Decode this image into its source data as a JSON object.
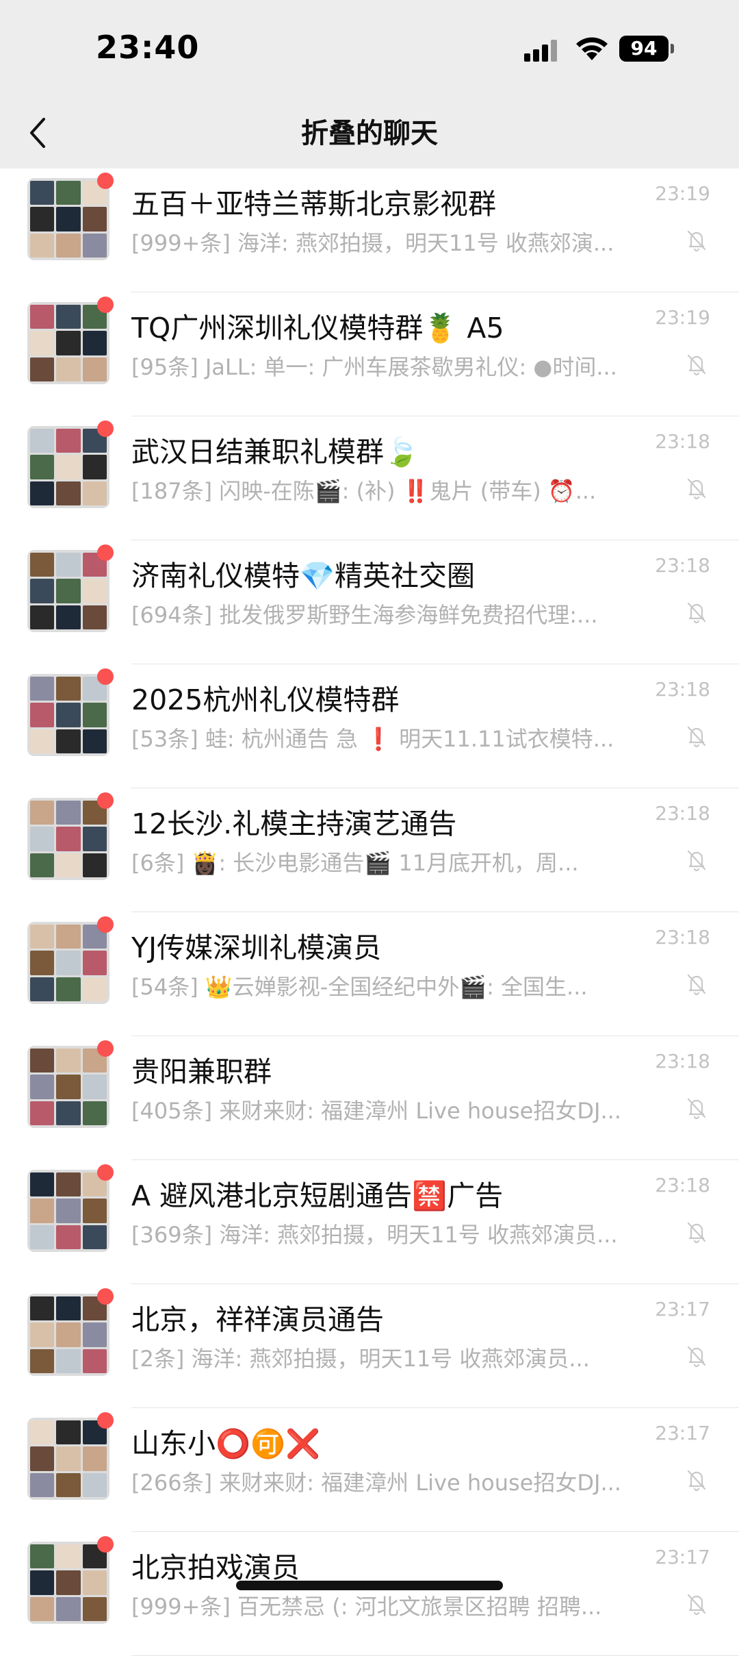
{
  "status": {
    "time": "23:40",
    "battery": "94"
  },
  "header": {
    "title": "折叠的聊天"
  },
  "colors": {
    "unread": "#fa5151",
    "background": "#ededed"
  },
  "chats": [
    {
      "name": "五百＋亚特兰蒂斯北京影视群",
      "preview": "[999+条] 海洋: 燕郊拍摄，明天11号 收燕郊演...",
      "time": "23:19"
    },
    {
      "name": "TQ广州深圳礼仪模特群🍍 A5",
      "preview": "[95条] JaLL: 单一: 广州车展茶歇男礼仪: ●时间...",
      "time": "23:19"
    },
    {
      "name": "武汉日结兼职礼模群🍃",
      "preview": "[187条] 闪映-在陈🎬: (补) ‼️鬼片 (带车) ⏰...",
      "time": "23:18"
    },
    {
      "name": "济南礼仪模特💎精英社交圈",
      "preview": "[694条] 批发俄罗斯野生海参海鲜免费招代理:...",
      "time": "23:18"
    },
    {
      "name": "2025杭州礼仪模特群",
      "preview": "[53条] 蛙: 杭州通告 急 ❗ 明天11.11试衣模特...",
      "time": "23:18"
    },
    {
      "name": "12长沙.礼模主持演艺通告",
      "preview": "[6条] 👸🏿: 长沙电影通告🎬 11月底开机，周...",
      "time": "23:18"
    },
    {
      "name": "YJ传媒深圳礼模演员",
      "preview": "[54条] 👑云婵影视-全国经纪中外🎬: 全国生...",
      "time": "23:18"
    },
    {
      "name": "贵阳兼职群",
      "preview": "[405条] 来财来财: 福建漳州 Live house招女DJ...",
      "time": "23:18"
    },
    {
      "name": "A 避风港北京短剧通告🈲广告",
      "preview": "[369条] 海洋: 燕郊拍摄，明天11号 收燕郊演员...",
      "time": "23:18"
    },
    {
      "name": "北京，祥祥演员通告",
      "preview": "[2条] 海洋: 燕郊拍摄，明天11号 收燕郊演员...",
      "time": "23:17"
    },
    {
      "name": "山东小⭕🉑❌",
      "preview": "[266条] 来财来财: 福建漳州 Live house招女DJ...",
      "time": "23:17"
    },
    {
      "name": "北京拍戏演员",
      "preview": "[999+条] 百无禁忌 (: 河北文旅景区招聘 招聘...",
      "time": "23:17"
    }
  ]
}
